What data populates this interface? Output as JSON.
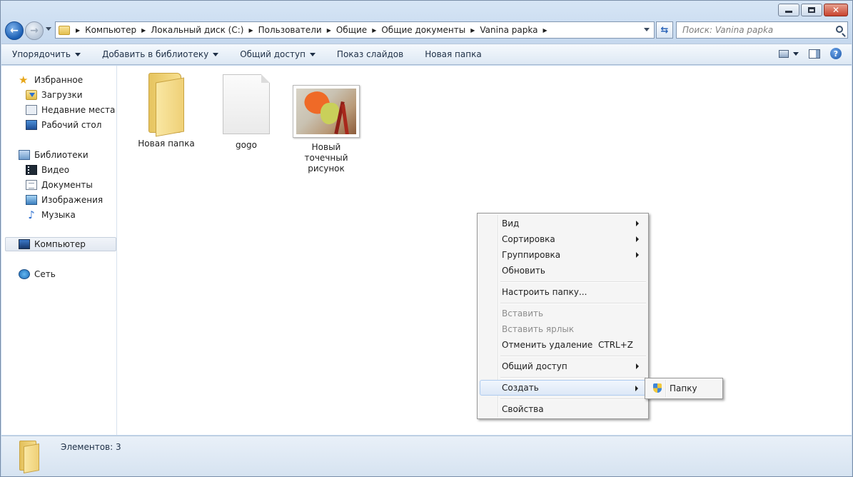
{
  "address": {
    "crumbs": [
      "Компьютер",
      "Локальный диск (C:)",
      "Пользователи",
      "Общие",
      "Общие документы",
      "Vanina papka"
    ]
  },
  "search": {
    "placeholder": "Поиск: Vanina papka"
  },
  "toolbar": {
    "organize": "Упорядочить",
    "add_to_library": "Добавить в библиотеку",
    "share": "Общий доступ",
    "slideshow": "Показ слайдов",
    "new_folder": "Новая папка"
  },
  "sidebar": {
    "favorites": "Избранное",
    "downloads": "Загрузки",
    "recent": "Недавние места",
    "desktop": "Рабочий стол",
    "libraries": "Библиотеки",
    "video": "Видео",
    "documents": "Документы",
    "images": "Изображения",
    "music": "Музыка",
    "computer": "Компьютер",
    "network": "Сеть"
  },
  "files": [
    {
      "name": "Новая папка",
      "icon": "folder-icon"
    },
    {
      "name": "gogo",
      "icon": "document-icon"
    },
    {
      "name": "Новый точечный рисунок",
      "icon": "bitmap-thumbnail"
    }
  ],
  "context_menu": {
    "view": "Вид",
    "sort": "Сортировка",
    "group": "Группировка",
    "refresh": "Обновить",
    "customize": "Настроить папку...",
    "paste": "Вставить",
    "paste_shortcut": "Вставить ярлык",
    "undo_delete": "Отменить удаление",
    "undo_shortcut": "CTRL+Z",
    "share": "Общий доступ",
    "create": "Создать",
    "properties": "Свойства"
  },
  "submenu": {
    "folder": "Папку"
  },
  "status": {
    "items_count": "Элементов: 3"
  }
}
